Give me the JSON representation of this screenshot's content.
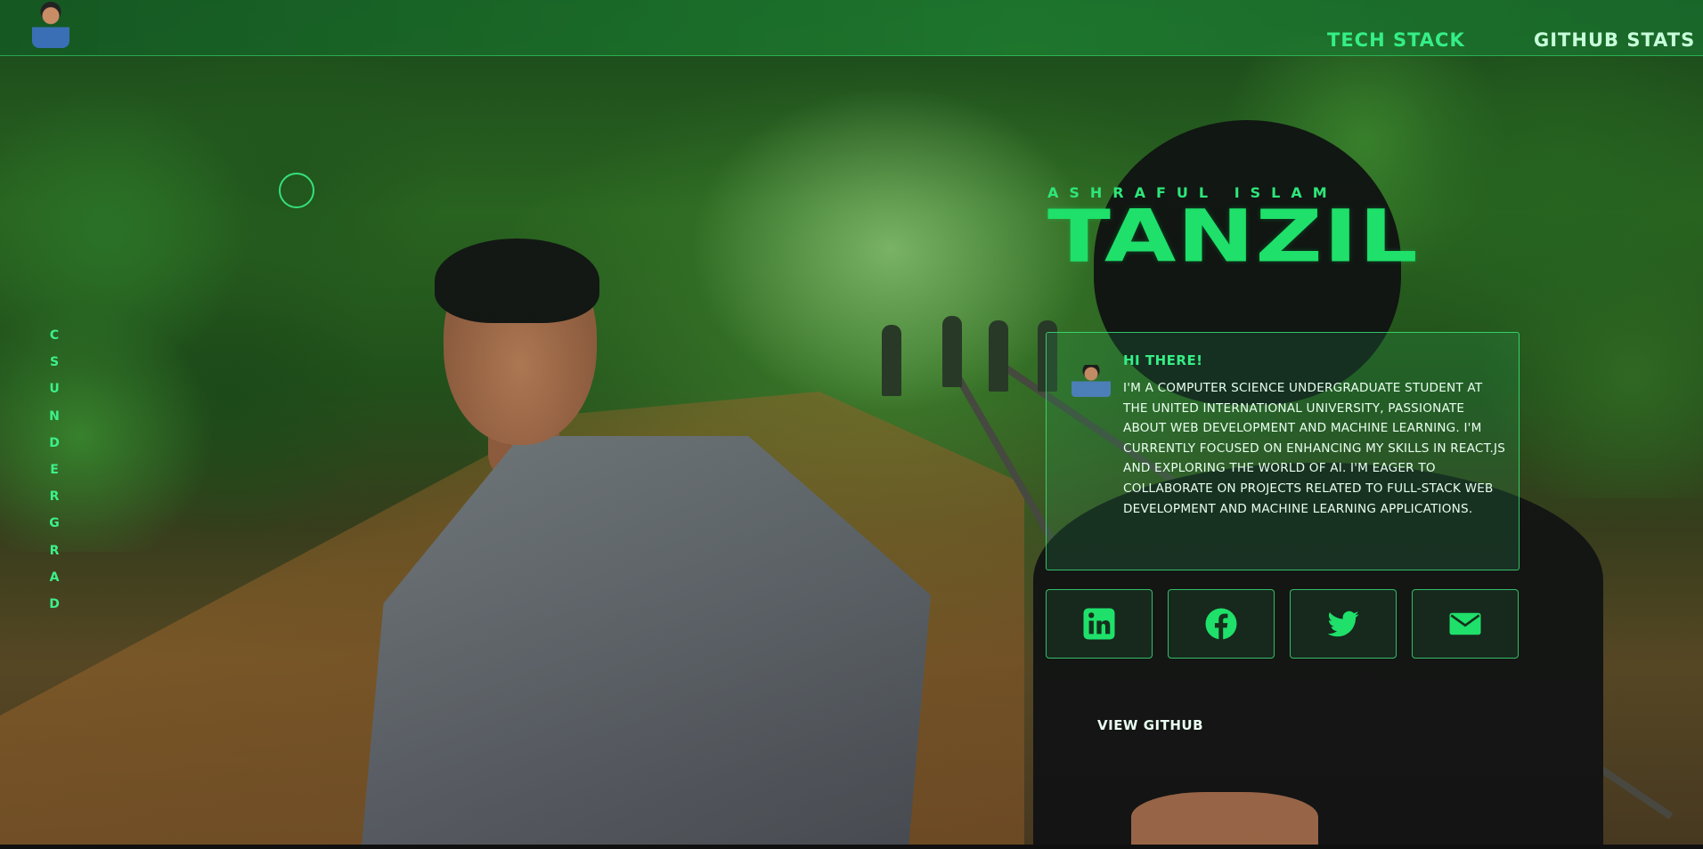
{
  "header": {
    "logo_icon": "profile-avatar",
    "nav": [
      {
        "label": "TECH STACK"
      },
      {
        "label": "GITHUB STATS"
      }
    ]
  },
  "sidebar_tag": "CS UNDERGRAD",
  "hero": {
    "subtitle": "ASHRAFUL ISLAM",
    "title": "TANZIL"
  },
  "intro": {
    "heading": "HI THERE!",
    "body": "I'm a Computer Science undergraduate student at the United International University, passionate about web development and machine learning. I'm currently focused on enhancing my skills in React.js and exploring the world of AI. I'm eager to collaborate on projects related to full-stack web development and machine learning applications."
  },
  "social": [
    {
      "icon": "linkedin-icon"
    },
    {
      "icon": "facebook-icon"
    },
    {
      "icon": "twitter-icon"
    },
    {
      "icon": "email-icon"
    }
  ],
  "cta": {
    "view_github": "VIEW GITHUB"
  },
  "colors": {
    "accent": "#2ee67a",
    "card_border": "#3cf082",
    "text_light": "#e9fff0"
  }
}
